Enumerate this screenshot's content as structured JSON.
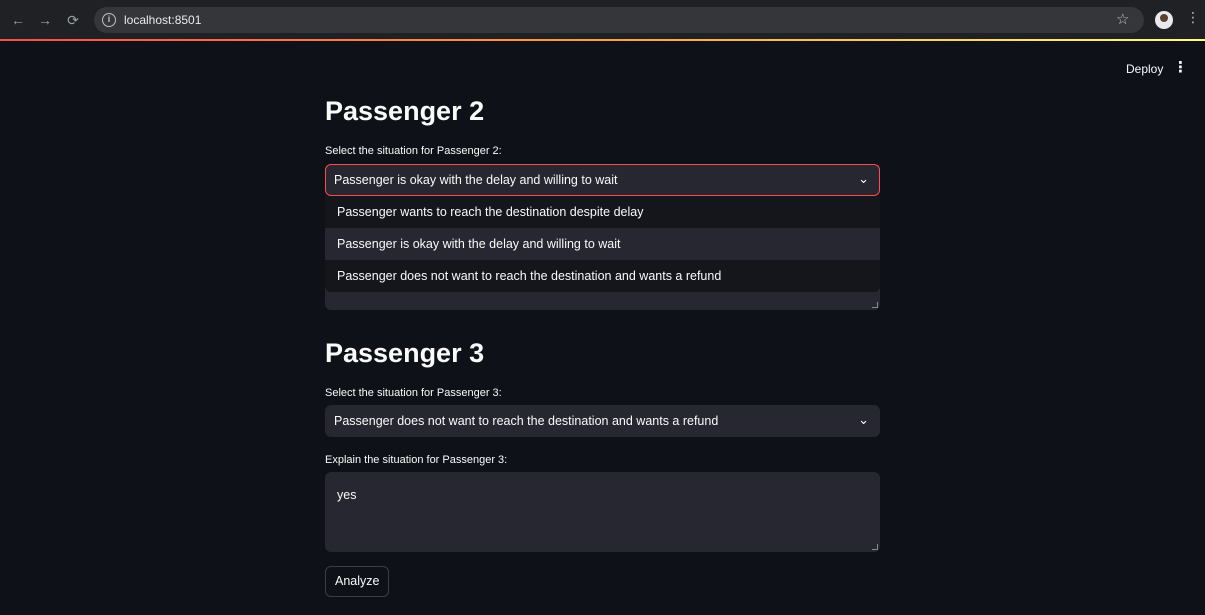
{
  "browser": {
    "url": "localhost:8501",
    "back_icon": "←",
    "forward_icon": "→",
    "reload_icon": "⟳"
  },
  "app": {
    "deploy_label": "Deploy",
    "menu_icon": "⋮"
  },
  "passenger2": {
    "title": "Passenger 2",
    "select_label": "Select the situation for Passenger 2:",
    "selected_value": "Passenger is okay with the delay and willing to wait",
    "options": [
      "Passenger wants to reach the destination despite delay",
      "Passenger is okay with the delay and willing to wait",
      "Passenger does not want to reach the destination and wants a refund"
    ]
  },
  "passenger3": {
    "title": "Passenger 3",
    "select_label": "Select the situation for Passenger 3:",
    "selected_value": "Passenger does not want to reach the destination and wants a refund",
    "explain_label": "Explain the situation for Passenger 3:",
    "explain_value": "yes"
  },
  "analyze_label": "Analyze",
  "colors": {
    "background": "#0e1117",
    "widget": "#262730",
    "accent": "#ff4b4b"
  }
}
